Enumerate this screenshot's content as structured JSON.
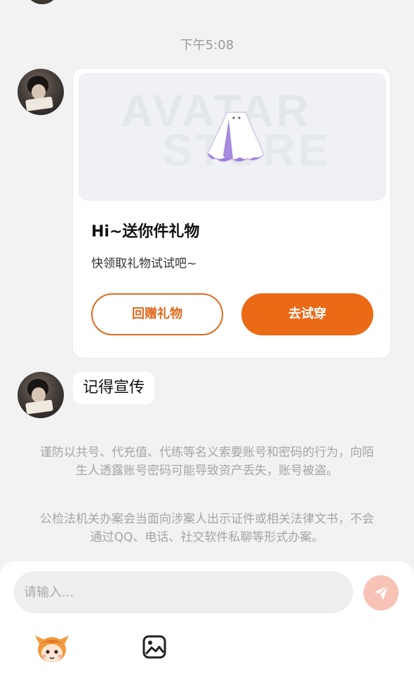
{
  "chat": {
    "timestamp": "下午5:08",
    "gift_card": {
      "banner_watermark_line1": "AVATAR",
      "banner_watermark_line2": "STORE",
      "title": "Hi~送你件礼物",
      "subtitle": "快领取礼物试试吧~",
      "return_gift_label": "回赠礼物",
      "try_on_label": "去试穿"
    },
    "message_text": "记得宣传",
    "notice_1": "谨防以共号、代充值、代练等名义索要账号和密码的行为，向陌生人透露账号密码可能导致资产丢失，账号被盗。",
    "notice_2": "公检法机关办案会当面向涉案人出示证件或相关法律文书，不会通过QQ、电话、社交软件私聊等形式办案。"
  },
  "input_bar": {
    "placeholder": "请输入..."
  },
  "colors": {
    "accent": "#eb6a16",
    "send_disabled": "#f7c3b6"
  },
  "icons": {
    "send": "send-icon",
    "mascot": "mascot-icon",
    "image": "image-icon"
  }
}
